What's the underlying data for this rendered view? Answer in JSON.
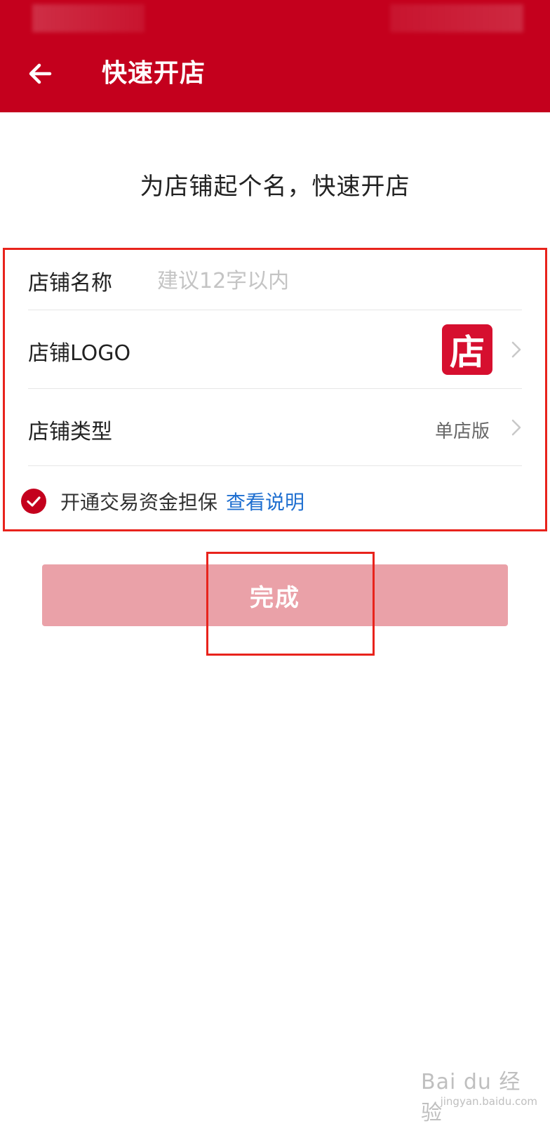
{
  "header": {
    "title": "快速开店",
    "back_icon": "arrow-left-icon",
    "background_color": "#c4001d"
  },
  "intro_text": "为店铺起个名，快速开店",
  "form": {
    "name": {
      "label": "店铺名称",
      "value": "",
      "placeholder": "建议12字以内"
    },
    "logo": {
      "label": "店铺LOGO",
      "logo_text": "店",
      "icon": "chevron-right-icon"
    },
    "type": {
      "label": "店铺类型",
      "value": "单店版",
      "icon": "chevron-right-icon"
    },
    "guarantee": {
      "checked": true,
      "text": "开通交易资金担保",
      "link": "查看说明"
    }
  },
  "done_button": {
    "label": "完成",
    "enabled": false
  },
  "watermark": {
    "main": "Bai du 经验",
    "sub": "jingyan.baidu.com"
  },
  "colors": {
    "brand_red": "#c4001d",
    "button_disabled": "#eaa1a8",
    "link_blue": "#1f6fd0",
    "highlight_red": "#e8231c"
  }
}
